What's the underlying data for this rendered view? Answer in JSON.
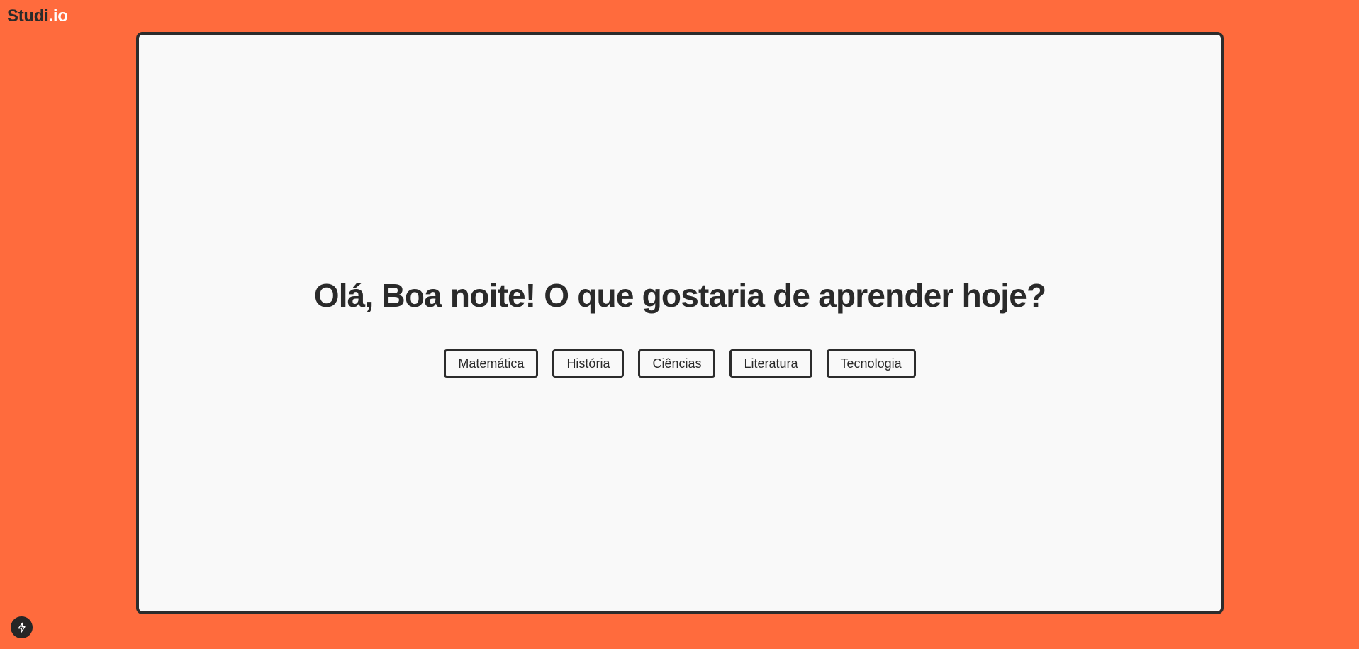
{
  "header": {
    "logo_main": "Studi",
    "logo_suffix": ".io"
  },
  "main": {
    "greeting": "Olá, Boa noite! O que gostaria de aprender hoje?",
    "topics": [
      {
        "label": "Matemática"
      },
      {
        "label": "História"
      },
      {
        "label": "Ciências"
      },
      {
        "label": "Literatura"
      },
      {
        "label": "Tecnologia"
      }
    ]
  },
  "footer": {
    "badge_icon": "lightning-bolt-icon"
  },
  "colors": {
    "background": "#ff6b3d",
    "panel": "#f9f9f9",
    "ink": "#2a2a2a"
  }
}
